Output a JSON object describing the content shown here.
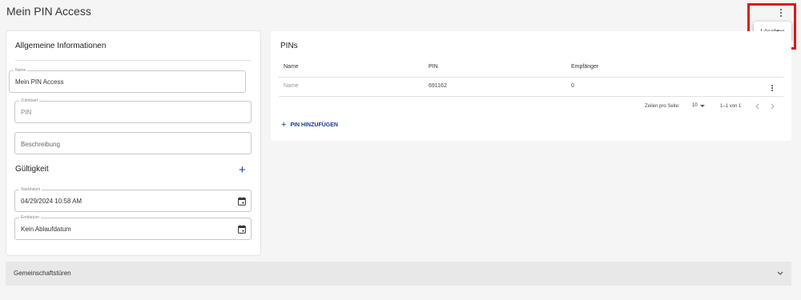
{
  "page": {
    "title": "Mein PIN Access"
  },
  "context_menu": {
    "delete_label": "Löschen"
  },
  "general_info": {
    "title": "Allgemeine Informationen",
    "name_label": "Name",
    "name_value": "Mein PIN Access",
    "access_type_label": "Zutrittsart",
    "access_type_value": "PIN",
    "description_placeholder": "Beschreibung"
  },
  "validity": {
    "title": "Gültigkeit",
    "start_label": "Startdatum",
    "start_value": "04/29/2024 10:58 AM",
    "end_label": "Enddatum",
    "end_value": "Kein Ablaufdatum"
  },
  "pins": {
    "title": "PINs",
    "columns": [
      "Name",
      "PIN",
      "Empfänger"
    ],
    "rows": [
      {
        "name": "Name",
        "pin": "691162",
        "recipients": "0"
      }
    ],
    "rows_per_page_label": "Zeilen pro Seite:",
    "rows_per_page_value": "10",
    "range_text": "1–1 von 1",
    "add_label": "PIN HINZUFÜGEN"
  },
  "community_doors": {
    "label": "Gemeinschaftstüren"
  },
  "colors": {
    "accent": "#1a3a8a",
    "highlight": "#e0151c",
    "background": "#f5f5f5"
  }
}
